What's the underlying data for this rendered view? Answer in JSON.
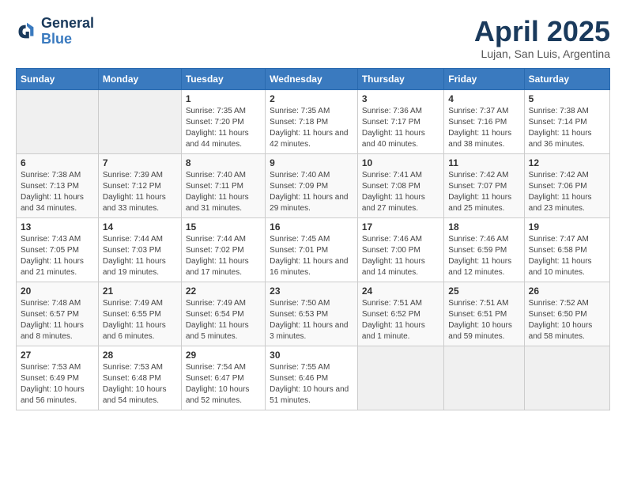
{
  "logo": {
    "line1": "General",
    "line2": "Blue"
  },
  "title": "April 2025",
  "subtitle": "Lujan, San Luis, Argentina",
  "weekdays": [
    "Sunday",
    "Monday",
    "Tuesday",
    "Wednesday",
    "Thursday",
    "Friday",
    "Saturday"
  ],
  "weeks": [
    [
      {
        "day": "",
        "sunrise": "",
        "sunset": "",
        "daylight": "",
        "empty": true
      },
      {
        "day": "",
        "sunrise": "",
        "sunset": "",
        "daylight": "",
        "empty": true
      },
      {
        "day": "1",
        "sunrise": "Sunrise: 7:35 AM",
        "sunset": "Sunset: 7:20 PM",
        "daylight": "Daylight: 11 hours and 44 minutes."
      },
      {
        "day": "2",
        "sunrise": "Sunrise: 7:35 AM",
        "sunset": "Sunset: 7:18 PM",
        "daylight": "Daylight: 11 hours and 42 minutes."
      },
      {
        "day": "3",
        "sunrise": "Sunrise: 7:36 AM",
        "sunset": "Sunset: 7:17 PM",
        "daylight": "Daylight: 11 hours and 40 minutes."
      },
      {
        "day": "4",
        "sunrise": "Sunrise: 7:37 AM",
        "sunset": "Sunset: 7:16 PM",
        "daylight": "Daylight: 11 hours and 38 minutes."
      },
      {
        "day": "5",
        "sunrise": "Sunrise: 7:38 AM",
        "sunset": "Sunset: 7:14 PM",
        "daylight": "Daylight: 11 hours and 36 minutes."
      }
    ],
    [
      {
        "day": "6",
        "sunrise": "Sunrise: 7:38 AM",
        "sunset": "Sunset: 7:13 PM",
        "daylight": "Daylight: 11 hours and 34 minutes."
      },
      {
        "day": "7",
        "sunrise": "Sunrise: 7:39 AM",
        "sunset": "Sunset: 7:12 PM",
        "daylight": "Daylight: 11 hours and 33 minutes."
      },
      {
        "day": "8",
        "sunrise": "Sunrise: 7:40 AM",
        "sunset": "Sunset: 7:11 PM",
        "daylight": "Daylight: 11 hours and 31 minutes."
      },
      {
        "day": "9",
        "sunrise": "Sunrise: 7:40 AM",
        "sunset": "Sunset: 7:09 PM",
        "daylight": "Daylight: 11 hours and 29 minutes."
      },
      {
        "day": "10",
        "sunrise": "Sunrise: 7:41 AM",
        "sunset": "Sunset: 7:08 PM",
        "daylight": "Daylight: 11 hours and 27 minutes."
      },
      {
        "day": "11",
        "sunrise": "Sunrise: 7:42 AM",
        "sunset": "Sunset: 7:07 PM",
        "daylight": "Daylight: 11 hours and 25 minutes."
      },
      {
        "day": "12",
        "sunrise": "Sunrise: 7:42 AM",
        "sunset": "Sunset: 7:06 PM",
        "daylight": "Daylight: 11 hours and 23 minutes."
      }
    ],
    [
      {
        "day": "13",
        "sunrise": "Sunrise: 7:43 AM",
        "sunset": "Sunset: 7:05 PM",
        "daylight": "Daylight: 11 hours and 21 minutes."
      },
      {
        "day": "14",
        "sunrise": "Sunrise: 7:44 AM",
        "sunset": "Sunset: 7:03 PM",
        "daylight": "Daylight: 11 hours and 19 minutes."
      },
      {
        "day": "15",
        "sunrise": "Sunrise: 7:44 AM",
        "sunset": "Sunset: 7:02 PM",
        "daylight": "Daylight: 11 hours and 17 minutes."
      },
      {
        "day": "16",
        "sunrise": "Sunrise: 7:45 AM",
        "sunset": "Sunset: 7:01 PM",
        "daylight": "Daylight: 11 hours and 16 minutes."
      },
      {
        "day": "17",
        "sunrise": "Sunrise: 7:46 AM",
        "sunset": "Sunset: 7:00 PM",
        "daylight": "Daylight: 11 hours and 14 minutes."
      },
      {
        "day": "18",
        "sunrise": "Sunrise: 7:46 AM",
        "sunset": "Sunset: 6:59 PM",
        "daylight": "Daylight: 11 hours and 12 minutes."
      },
      {
        "day": "19",
        "sunrise": "Sunrise: 7:47 AM",
        "sunset": "Sunset: 6:58 PM",
        "daylight": "Daylight: 11 hours and 10 minutes."
      }
    ],
    [
      {
        "day": "20",
        "sunrise": "Sunrise: 7:48 AM",
        "sunset": "Sunset: 6:57 PM",
        "daylight": "Daylight: 11 hours and 8 minutes."
      },
      {
        "day": "21",
        "sunrise": "Sunrise: 7:49 AM",
        "sunset": "Sunset: 6:55 PM",
        "daylight": "Daylight: 11 hours and 6 minutes."
      },
      {
        "day": "22",
        "sunrise": "Sunrise: 7:49 AM",
        "sunset": "Sunset: 6:54 PM",
        "daylight": "Daylight: 11 hours and 5 minutes."
      },
      {
        "day": "23",
        "sunrise": "Sunrise: 7:50 AM",
        "sunset": "Sunset: 6:53 PM",
        "daylight": "Daylight: 11 hours and 3 minutes."
      },
      {
        "day": "24",
        "sunrise": "Sunrise: 7:51 AM",
        "sunset": "Sunset: 6:52 PM",
        "daylight": "Daylight: 11 hours and 1 minute."
      },
      {
        "day": "25",
        "sunrise": "Sunrise: 7:51 AM",
        "sunset": "Sunset: 6:51 PM",
        "daylight": "Daylight: 10 hours and 59 minutes."
      },
      {
        "day": "26",
        "sunrise": "Sunrise: 7:52 AM",
        "sunset": "Sunset: 6:50 PM",
        "daylight": "Daylight: 10 hours and 58 minutes."
      }
    ],
    [
      {
        "day": "27",
        "sunrise": "Sunrise: 7:53 AM",
        "sunset": "Sunset: 6:49 PM",
        "daylight": "Daylight: 10 hours and 56 minutes."
      },
      {
        "day": "28",
        "sunrise": "Sunrise: 7:53 AM",
        "sunset": "Sunset: 6:48 PM",
        "daylight": "Daylight: 10 hours and 54 minutes."
      },
      {
        "day": "29",
        "sunrise": "Sunrise: 7:54 AM",
        "sunset": "Sunset: 6:47 PM",
        "daylight": "Daylight: 10 hours and 52 minutes."
      },
      {
        "day": "30",
        "sunrise": "Sunrise: 7:55 AM",
        "sunset": "Sunset: 6:46 PM",
        "daylight": "Daylight: 10 hours and 51 minutes."
      },
      {
        "day": "",
        "sunrise": "",
        "sunset": "",
        "daylight": "",
        "empty": true
      },
      {
        "day": "",
        "sunrise": "",
        "sunset": "",
        "daylight": "",
        "empty": true
      },
      {
        "day": "",
        "sunrise": "",
        "sunset": "",
        "daylight": "",
        "empty": true
      }
    ]
  ]
}
